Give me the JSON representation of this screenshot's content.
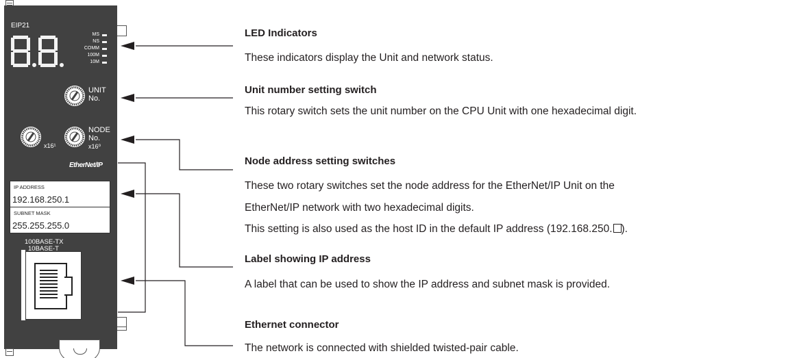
{
  "unit": {
    "model": "EIP21",
    "led_labels": [
      "MS",
      "NS",
      "COMM",
      "100M",
      "10M"
    ],
    "unit_switch_label": [
      "UNIT",
      "No."
    ],
    "node_switch_label": [
      "NODE",
      "No.",
      "x16⁰"
    ],
    "x16_1": "x16¹",
    "logo": "EtherNet/IP",
    "ip_label": {
      "ip_caption": "IP ADDRESS",
      "ip_value": "192.168.250.1",
      "mask_caption": "SUBNET MASK",
      "mask_value": "255.255.255.0"
    },
    "port_captions": [
      "100BASE-TX",
      "10BASE-T"
    ]
  },
  "callouts": [
    {
      "title": "LED Indicators",
      "lines": [
        "These indicators display the Unit and network status."
      ]
    },
    {
      "title": "Unit number setting switch",
      "lines": [
        "This rotary switch sets the unit number on the CPU Unit with one hexadecimal digit."
      ]
    },
    {
      "title": "Node address setting switches",
      "lines": [
        "These two rotary switches set the node address for the EtherNet/IP Unit on the",
        "EtherNet/IP network with two hexadecimal digits.",
        "This setting is also used as the host ID in the default IP address (192.168.250."
      ],
      "line3_suffix": ")."
    },
    {
      "title": "Label showing IP address",
      "lines": [
        "A label that can be used to show the IP address and subnet mask is provided."
      ]
    },
    {
      "title": "Ethernet connector",
      "lines": [
        "The network is connected with shielded twisted-pair cable."
      ]
    }
  ]
}
